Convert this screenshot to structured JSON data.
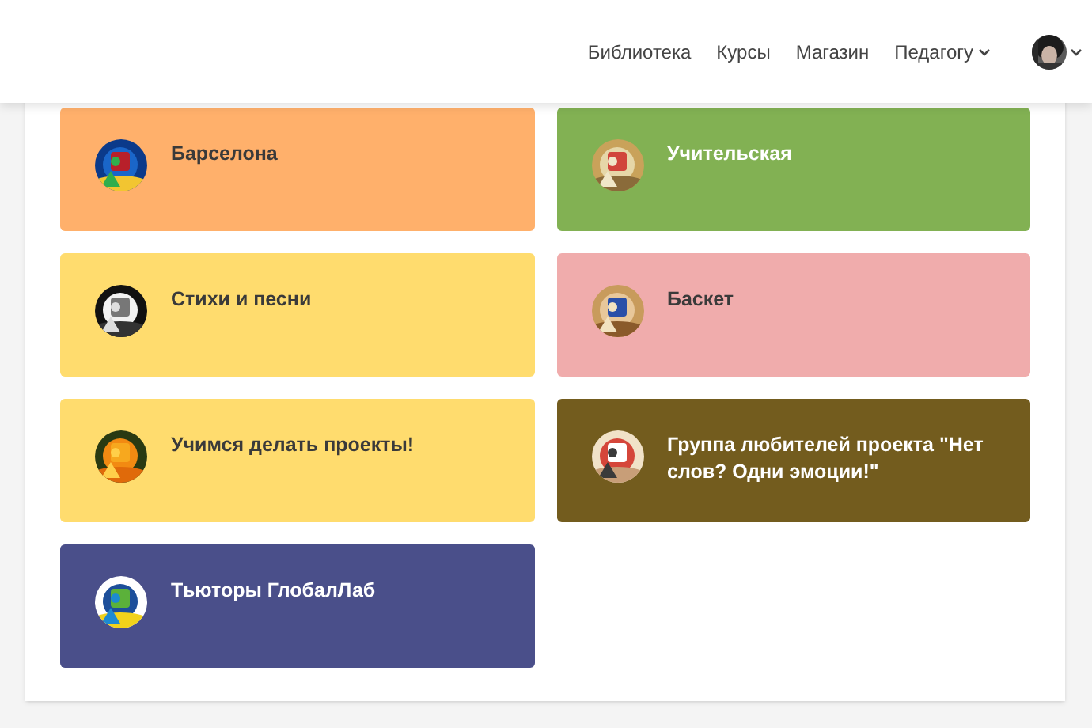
{
  "nav": {
    "items": [
      {
        "label": "Библиотека",
        "kind": "link"
      },
      {
        "label": "Курсы",
        "kind": "link"
      },
      {
        "label": "Магазин",
        "kind": "link"
      },
      {
        "label": "Педагогу",
        "kind": "dropdown"
      }
    ]
  },
  "groups": [
    {
      "title": "Барселона",
      "color": "#ffb06b"
    },
    {
      "title": "Учительская",
      "color": "#82b153"
    },
    {
      "title": "Стихи и песни",
      "color": "#ffdc6e"
    },
    {
      "title": "Баскет",
      "color": "#f0acac"
    },
    {
      "title": "Учимся делать проекты!",
      "color": "#ffdc6e"
    },
    {
      "title": "Группа любителей проекта \"Нет слов? Одни эмоции!\"",
      "color": "#735c1e"
    },
    {
      "title": "Тьюторы ГлобалЛаб",
      "color": "#4a4f8a"
    }
  ]
}
